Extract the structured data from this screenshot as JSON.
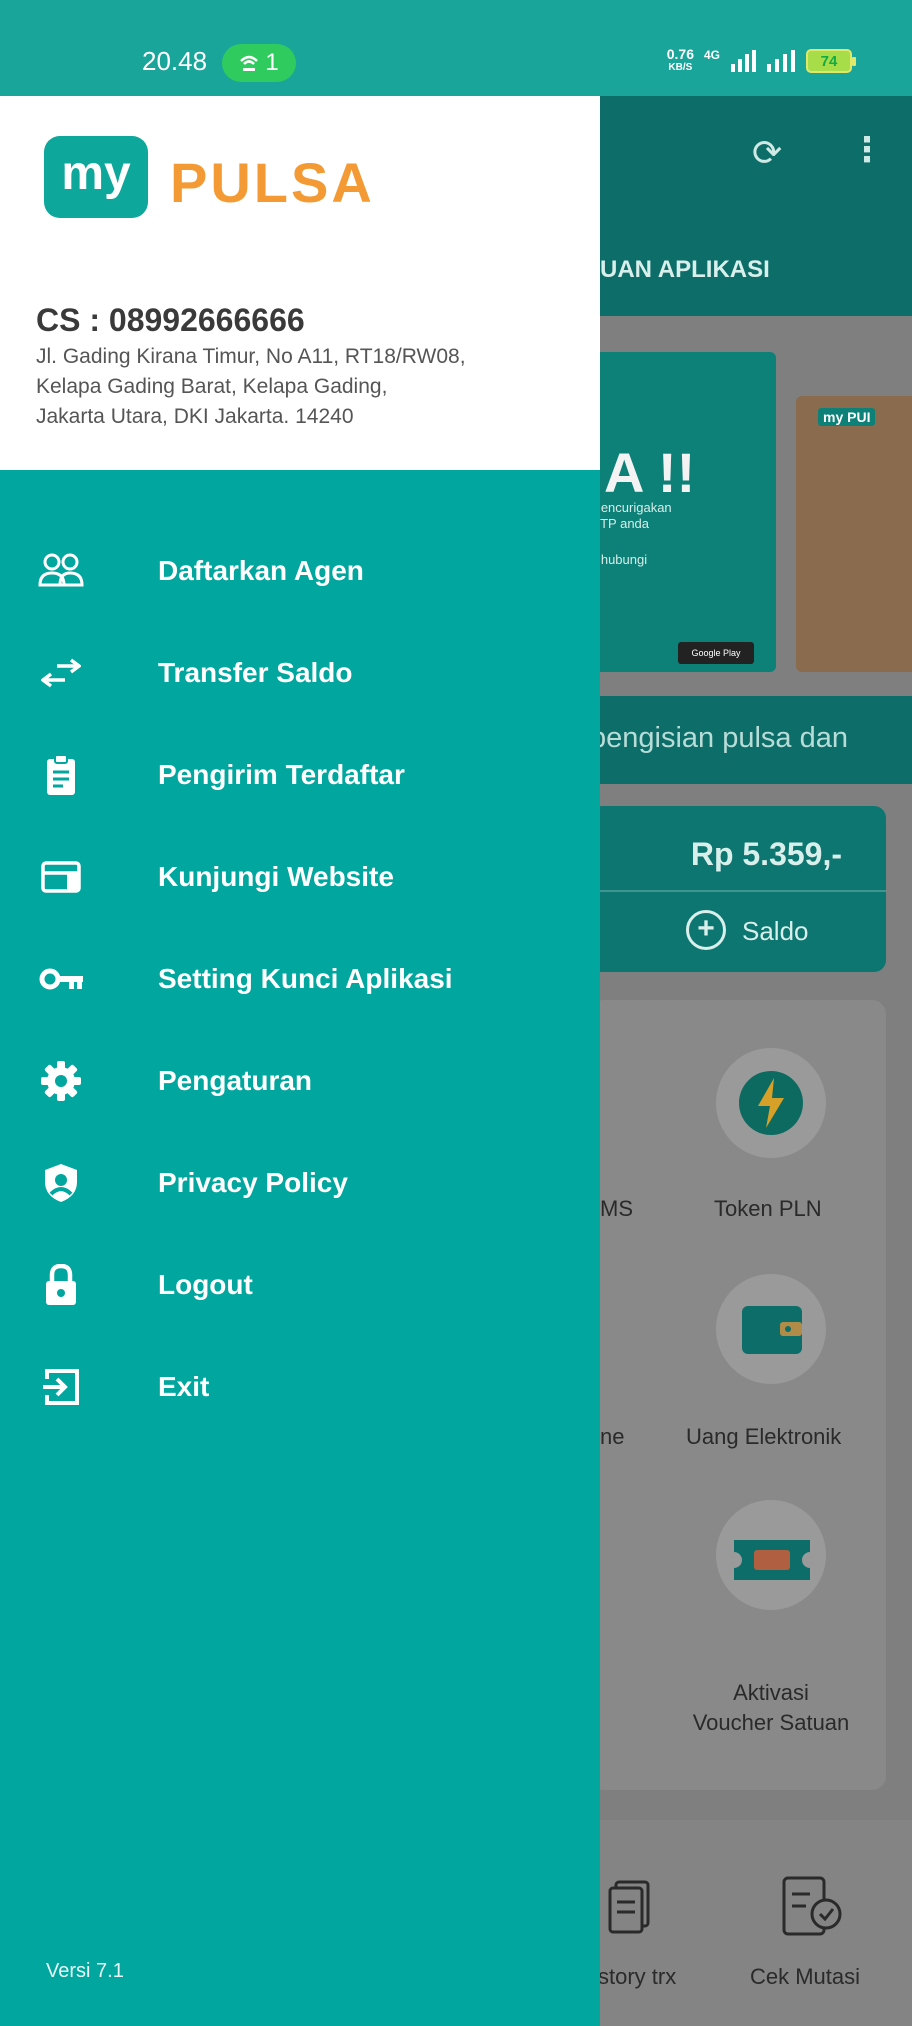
{
  "status_bar": {
    "time": "20.48",
    "hotspot_count": "1",
    "net_speed_value": "0.76",
    "net_speed_unit": "KB/S",
    "network_type": "4G",
    "battery": "74"
  },
  "background_app": {
    "tab_label": "UAN APLIKASI",
    "banner_headline": "A !!",
    "banner_text_1": "mencurigakan",
    "banner_text_2": "OTP anda",
    "banner_text_3": "g hubungi",
    "google_play": "Google Play",
    "banner2_logo": "my PUI",
    "marquee": "pengisian pulsa dan",
    "saldo_amount": "Rp 5.359,-",
    "saldo_label": "Saldo",
    "items": {
      "sms_fragment": "MS",
      "token_pln": "Token PLN",
      "phone_fragment": "ne",
      "uang_elektronik": "Uang Elektronik",
      "aktivasi_voucher_line1": "Aktivasi",
      "aktivasi_voucher_line2": "Voucher Satuan"
    },
    "bottom_nav": {
      "history": "story trx",
      "cek_mutasi": "Cek Mutasi"
    }
  },
  "drawer": {
    "logo_my": "my",
    "logo_pulsa": "PULSA",
    "cs_phone": "CS : 08992666666",
    "address_line1": "Jl. Gading Kirana Timur, No A11, RT18/RW08,",
    "address_line2": "Kelapa Gading Barat, Kelapa Gading,",
    "address_line3": "Jakarta Utara, DKI Jakarta. 14240",
    "menu": [
      {
        "label": "Daftarkan Agen",
        "icon": "people-icon"
      },
      {
        "label": "Transfer Saldo",
        "icon": "transfer-arrows-icon"
      },
      {
        "label": "Pengirim Terdaftar",
        "icon": "clipboard-icon"
      },
      {
        "label": "Kunjungi Website",
        "icon": "browser-window-icon"
      },
      {
        "label": "Setting Kunci Aplikasi",
        "icon": "key-icon"
      },
      {
        "label": "Pengaturan",
        "icon": "gear-icon"
      },
      {
        "label": "Privacy Policy",
        "icon": "shield-user-icon"
      },
      {
        "label": "Logout",
        "icon": "lock-icon"
      },
      {
        "label": "Exit",
        "icon": "exit-icon"
      }
    ],
    "version": "Versi 7.1"
  },
  "colors": {
    "primary": "#01a69e",
    "status_bar": "#1aa59a",
    "logo_orange": "#f39a34"
  }
}
